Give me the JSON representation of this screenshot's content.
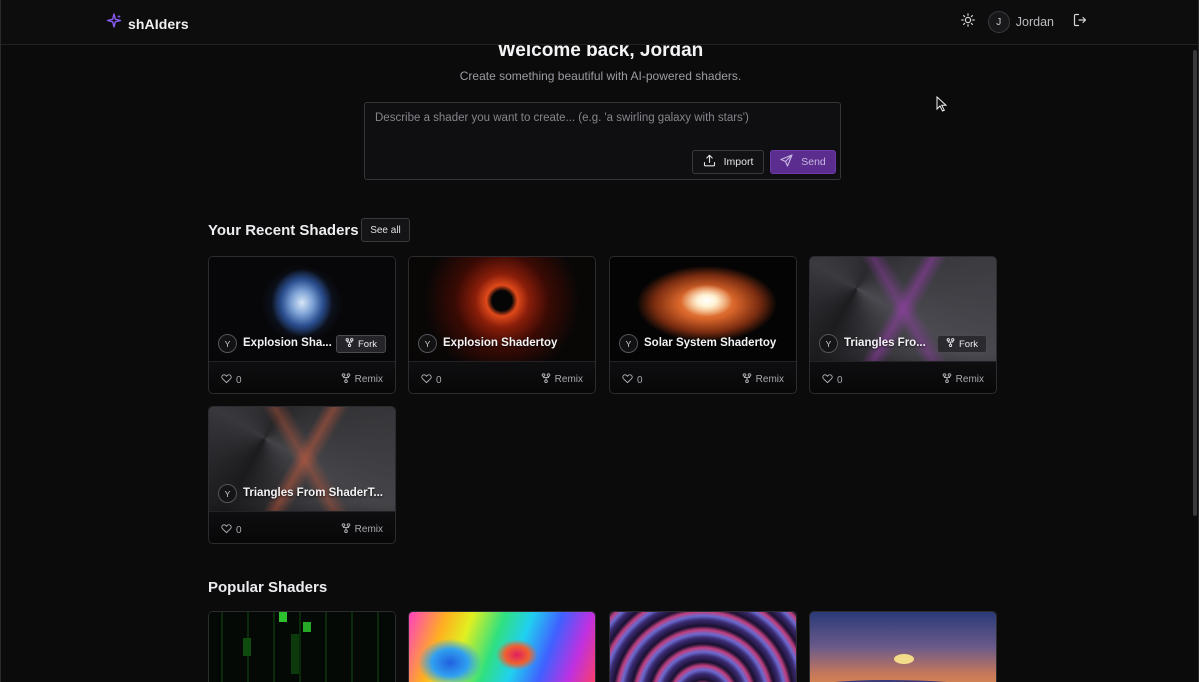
{
  "app": {
    "name": "shAIders"
  },
  "header": {
    "user_initial": "J",
    "user_name": "Jordan"
  },
  "welcome": {
    "title": "Welcome back, Jordan",
    "subtitle": "Create something beautiful with AI-powered shaders."
  },
  "prompt": {
    "placeholder": "Describe a shader you want to create... (e.g. 'a swirling galaxy with stars')",
    "import_label": "Import",
    "send_label": "Send"
  },
  "recent": {
    "title": "Your Recent Shaders",
    "see_all_label": "See all",
    "cards": [
      {
        "initial": "Y",
        "title": "Explosion Sha...",
        "fork_label": "Fork",
        "likes": "0",
        "remix_label": "Remix"
      },
      {
        "initial": "Y",
        "title": "Explosion Shadertoy",
        "likes": "0",
        "remix_label": "Remix"
      },
      {
        "initial": "Y",
        "title": "Solar System Shadertoy",
        "likes": "0",
        "remix_label": "Remix"
      },
      {
        "initial": "Y",
        "title": "Triangles Fro...",
        "fork_label": "Fork",
        "likes": "0",
        "remix_label": "Remix"
      },
      {
        "initial": "Y",
        "title": "Triangles From ShaderT...",
        "likes": "0",
        "remix_label": "Remix"
      }
    ]
  },
  "popular": {
    "title": "Popular Shaders"
  }
}
